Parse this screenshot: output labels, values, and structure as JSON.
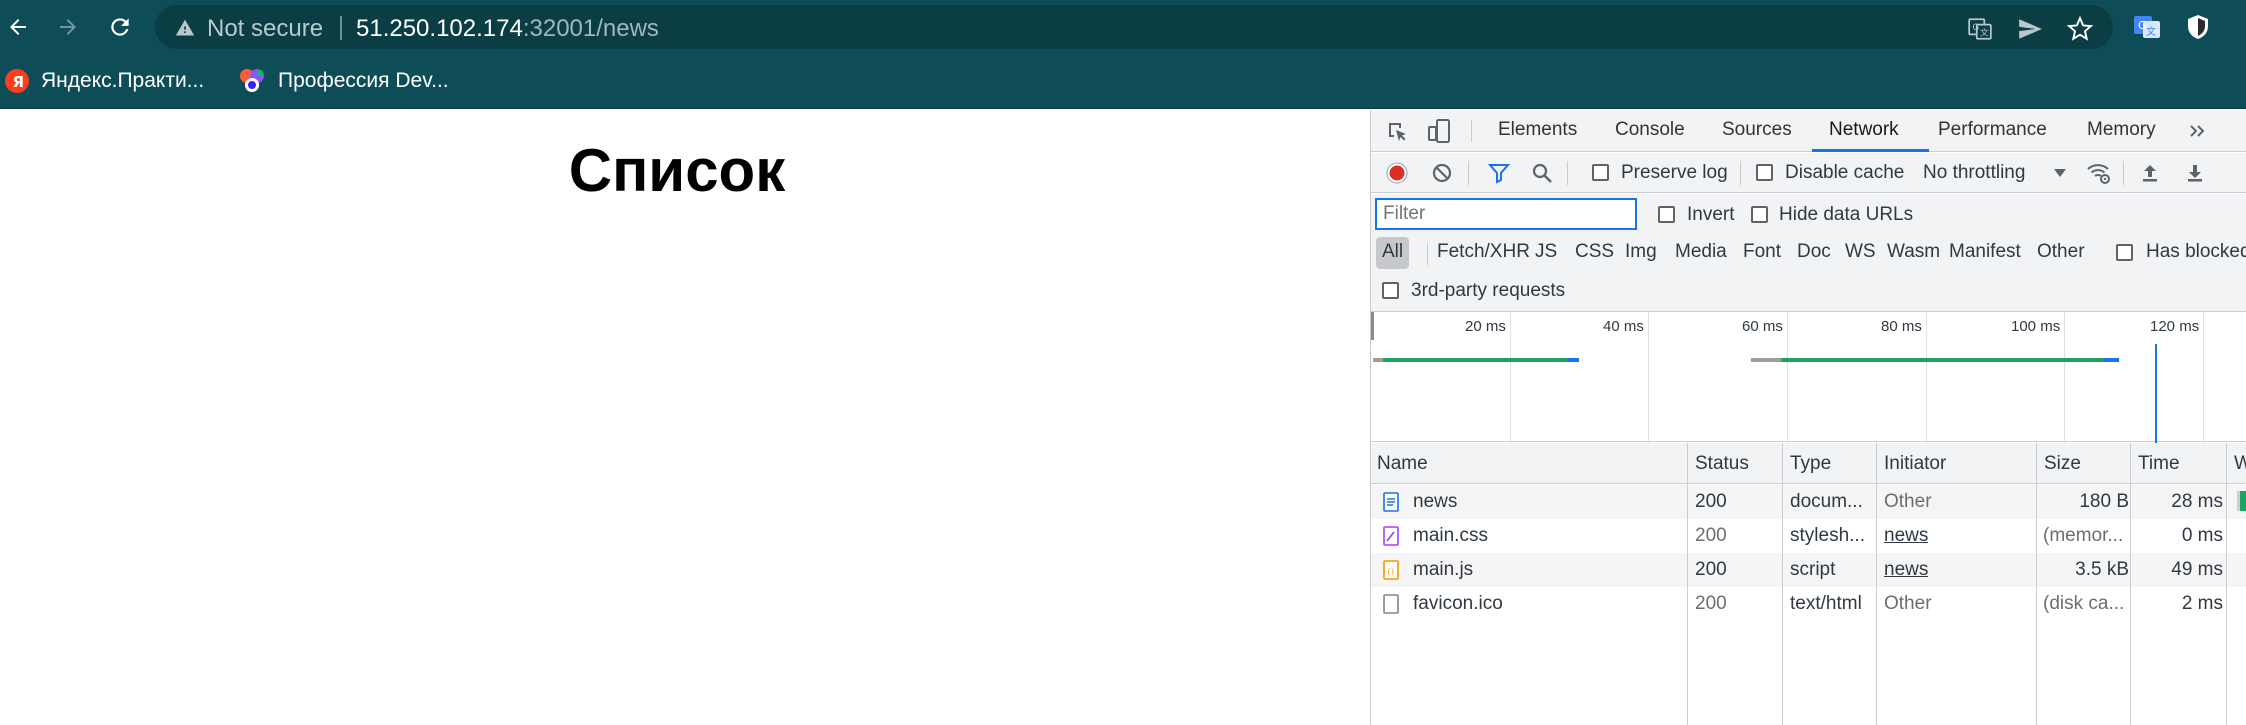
{
  "browser": {
    "not_secure_label": "Not secure",
    "url_host": "51.250.102.174",
    "url_rest": ":32001/news",
    "bookmarks": [
      {
        "label": "Яндекс.Практи...",
        "icon": "yandex-icon"
      },
      {
        "label": "Профессия Dev...",
        "icon": "multicolor-logo-icon"
      }
    ]
  },
  "page": {
    "title": "Список"
  },
  "devtools": {
    "tabs": [
      "Elements",
      "Console",
      "Sources",
      "Network",
      "Performance",
      "Memory"
    ],
    "active_tab": "Network",
    "toolbar": {
      "preserve_log": "Preserve log",
      "disable_cache": "Disable cache",
      "throttling": "No throttling"
    },
    "filter": {
      "placeholder": "Filter",
      "invert": "Invert",
      "hide_data_urls": "Hide data URLs"
    },
    "types": [
      "All",
      "Fetch/XHR",
      "JS",
      "CSS",
      "Img",
      "Media",
      "Font",
      "Doc",
      "WS",
      "Wasm",
      "Manifest",
      "Other"
    ],
    "active_type": "All",
    "has_blocked": "Has blocked",
    "third_party": "3rd-party requests",
    "timeline_labels": [
      "20 ms",
      "40 ms",
      "60 ms",
      "80 ms",
      "100 ms",
      "120 ms"
    ],
    "columns": [
      "Name",
      "Status",
      "Type",
      "Initiator",
      "Size",
      "Time",
      "W"
    ],
    "rows": [
      {
        "name": "news",
        "status": "200",
        "type": "docum...",
        "initiator": "Other",
        "size": "180 B",
        "time": "28 ms",
        "icon": "document-icon"
      },
      {
        "name": "main.css",
        "status": "200",
        "type": "stylesh...",
        "initiator": "news",
        "size": "(memor...",
        "time": "0 ms",
        "icon": "stylesheet-icon"
      },
      {
        "name": "main.js",
        "status": "200",
        "type": "script",
        "initiator": "news",
        "size": "3.5 kB",
        "time": "49 ms",
        "icon": "script-icon"
      },
      {
        "name": "favicon.ico",
        "status": "200",
        "type": "text/html",
        "initiator": "Other",
        "size": "(disk ca...",
        "time": "2 ms",
        "icon": "file-icon"
      }
    ]
  },
  "colors": {
    "chrome_bg": "#0e4d57",
    "omnibox_bg": "#0a3d44",
    "accent": "#1a73e8",
    "record": "#d93025",
    "timeline_green": "#1da462",
    "timeline_blue": "#1a73e8"
  }
}
